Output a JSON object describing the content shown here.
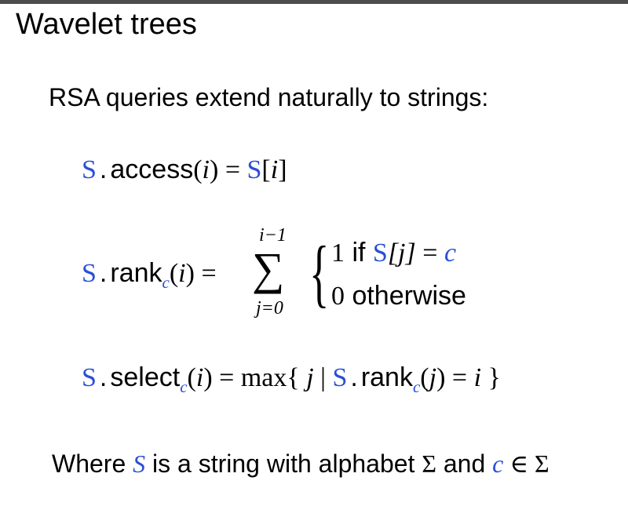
{
  "slide": {
    "title": "Wavelet trees",
    "intro": "RSA queries extend naturally to strings:"
  },
  "access_formula": {
    "var": "S",
    "dot": ".",
    "method": "access",
    "open": "(",
    "arg": "i",
    "close": ")",
    "eq": " = ",
    "rhs_var": "S",
    "rhs_open": "[",
    "rhs_idx": "i",
    "rhs_close": "]"
  },
  "rank_formula": {
    "var": "S",
    "dot": ".",
    "method": "rank",
    "sub": "c",
    "open": "(",
    "arg": "i",
    "close": ")",
    "eq": " =",
    "sum_upper": "i−1",
    "sum_symbol": "∑",
    "sum_lower": "j=0",
    "brace": "{",
    "case1_value": "1",
    "case1_if": " if ",
    "case1_var": "S",
    "case1_index": "[j]",
    "case1_eq": " = ",
    "case1_c": "c",
    "case2_value": "0",
    "case2_text": " otherwise"
  },
  "select_formula": {
    "var": "S",
    "dot": ".",
    "method": "select",
    "sub": "c",
    "open": "(",
    "arg": "i",
    "close": ")",
    "eq": " = ",
    "max": "max{",
    "j": " j",
    "bar": " | ",
    "inner_var": "S",
    "inner_dot": ".",
    "inner_method": "rank",
    "inner_sub": "c",
    "inner_open": "(",
    "inner_arg": "j",
    "inner_close": ")",
    "inner_eq": " = ",
    "inner_i": "i",
    "end": " }"
  },
  "footer": {
    "where": "Where ",
    "S": "S",
    "is_string": " is a string with alphabet ",
    "sigma1": "Σ",
    "and": " and ",
    "c": "c",
    "in": " ∈ ",
    "sigma2": "Σ"
  }
}
